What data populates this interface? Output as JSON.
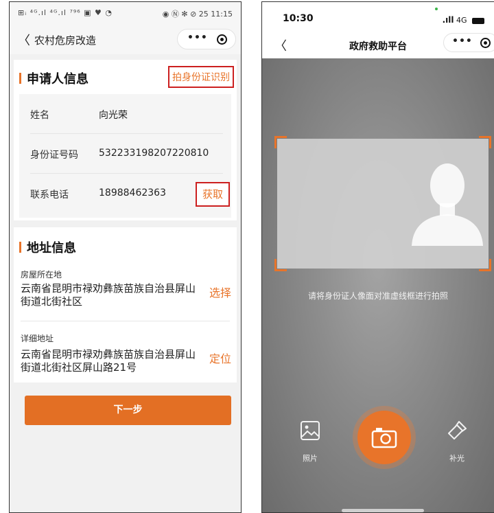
{
  "left": {
    "status_bar": {
      "left_text": "⊞ᵢ ⁴ᴳ.ıl ⁴ᴳ.ıl ⁷⁹⁶ ▣ ♥ ◔",
      "right_text": "◉ Ⓝ ✻ ⊘ 25 11:15"
    },
    "nav": {
      "back_glyph": "〈",
      "title": "农村危房改造",
      "more_glyph": "•••"
    },
    "applicant": {
      "section_title": "申请人信息",
      "ocr_link": "拍身份证识别",
      "fields": [
        {
          "label": "姓名",
          "value": "向光荣"
        },
        {
          "label": "身份证号码",
          "value": "532233198207220810"
        },
        {
          "label": "联系电话",
          "value": "18988462363"
        }
      ],
      "fetch_button": "获取"
    },
    "address": {
      "section_title": "地址信息",
      "house_label": "房屋所在地",
      "house_value": "云南省昆明市禄劝彝族苗族自治县屏山街道北街社区",
      "house_action": "选择",
      "detail_label": "详细地址",
      "detail_value": "云南省昆明市禄劝彝族苗族自治县屏山街道北街社区屏山路21号",
      "detail_action": "定位"
    },
    "next_button": "下一步"
  },
  "right": {
    "status_bar": {
      "time": "10:30",
      "network": "4G"
    },
    "nav": {
      "back_glyph": "〈",
      "title": "政府救助平台",
      "more_glyph": "•••"
    },
    "hint": "请将身份证人像面对准虚线框进行拍照",
    "photo_label": "照片",
    "light_label": "补光"
  },
  "colors": {
    "accent": "#e8742a",
    "highlight_border": "#cc1f1f",
    "camera_bg": "#8c8c8c"
  },
  "icons": [
    "image-icon",
    "camera-icon",
    "flashlight-icon",
    "back-arrow-icon",
    "more-icon",
    "target-icon",
    "person-silhouette-icon"
  ]
}
